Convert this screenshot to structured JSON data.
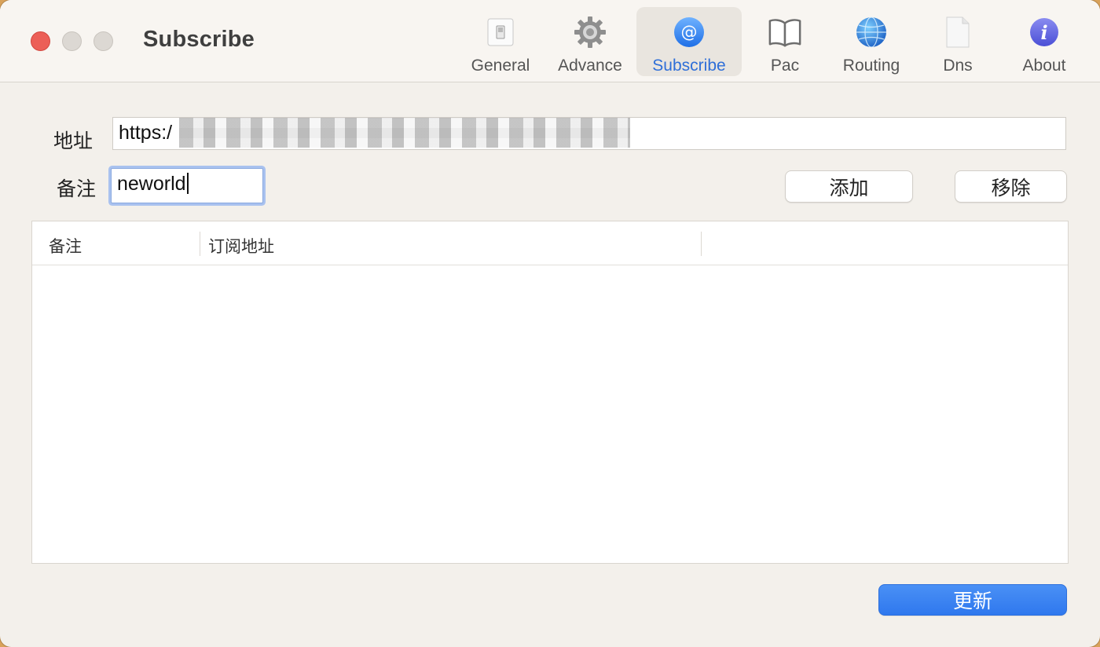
{
  "window": {
    "title": "Subscribe"
  },
  "toolbar": {
    "tabs": [
      {
        "id": "general",
        "label": "General",
        "icon": "switch-icon"
      },
      {
        "id": "advance",
        "label": "Advance",
        "icon": "gear-icon"
      },
      {
        "id": "subscribe",
        "label": "Subscribe",
        "icon": "at-sign-icon",
        "selected": true
      },
      {
        "id": "pac",
        "label": "Pac",
        "icon": "book-icon"
      },
      {
        "id": "routing",
        "label": "Routing",
        "icon": "globe-icon"
      },
      {
        "id": "dns",
        "label": "Dns",
        "icon": "document-icon"
      },
      {
        "id": "about",
        "label": "About",
        "icon": "info-icon"
      }
    ]
  },
  "form": {
    "url_label": "地址",
    "url_value": "https:/",
    "note_label": "备注",
    "note_value": "neworld",
    "add_label": "添加",
    "remove_label": "移除"
  },
  "table": {
    "columns": [
      "备注",
      "订阅地址",
      ""
    ],
    "rows": []
  },
  "footer": {
    "update_label": "更新"
  },
  "colors": {
    "accent": "#2f78ee",
    "close": "#ec5f57",
    "selected_text": "#2f6fd8"
  }
}
